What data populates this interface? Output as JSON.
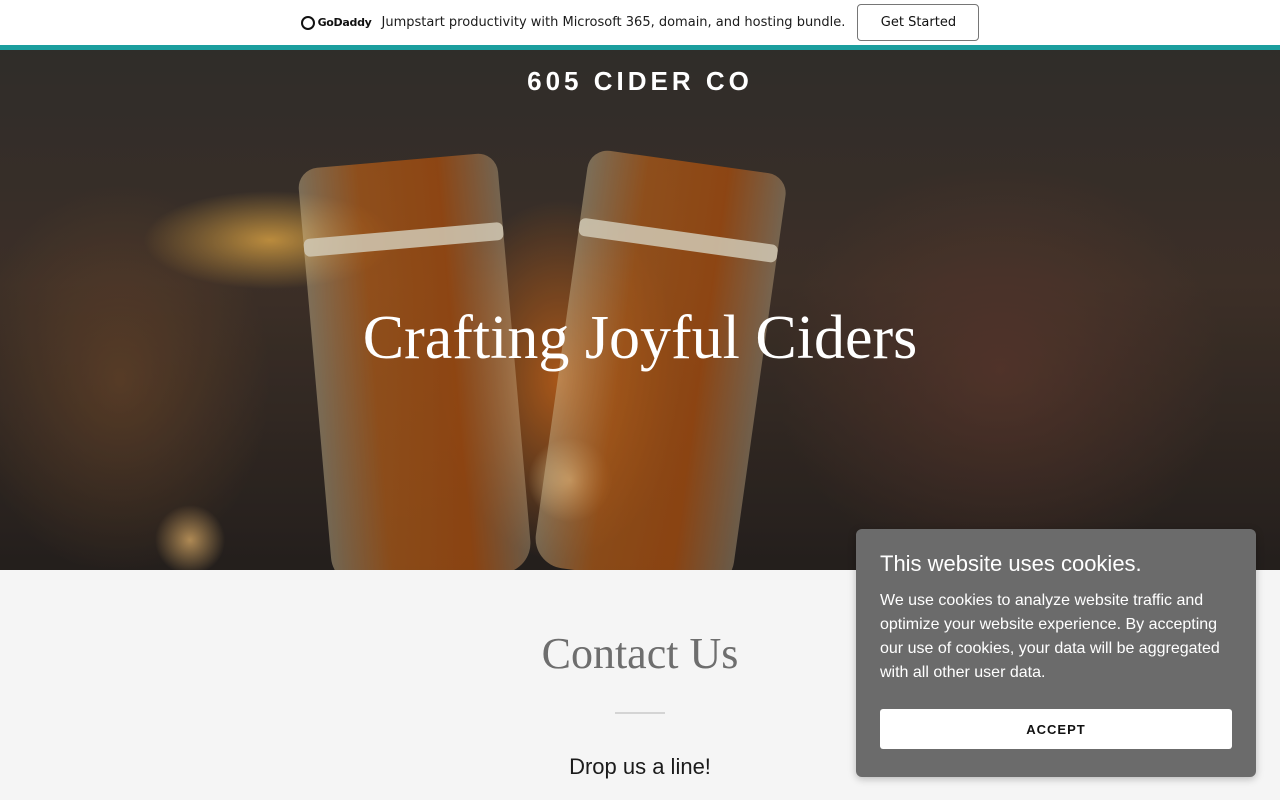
{
  "promo_bar": {
    "logo_text": "GoDaddy",
    "message": "Jumpstart productivity with Microsoft 365, domain, and hosting bundle.",
    "cta_label": "Get Started",
    "accent_color": "#1b9e9e"
  },
  "hero": {
    "brand_name": "605 CIDER CO",
    "headline": "Crafting Joyful Ciders"
  },
  "contact": {
    "title": "Contact Us",
    "subtitle": "Drop us a line!"
  },
  "cookie_banner": {
    "title": "This website uses cookies.",
    "body": "We use cookies to analyze website traffic and optimize your website experience. By accepting our use of cookies, your data will be aggregated with all other user data.",
    "accept_label": "ACCEPT"
  }
}
